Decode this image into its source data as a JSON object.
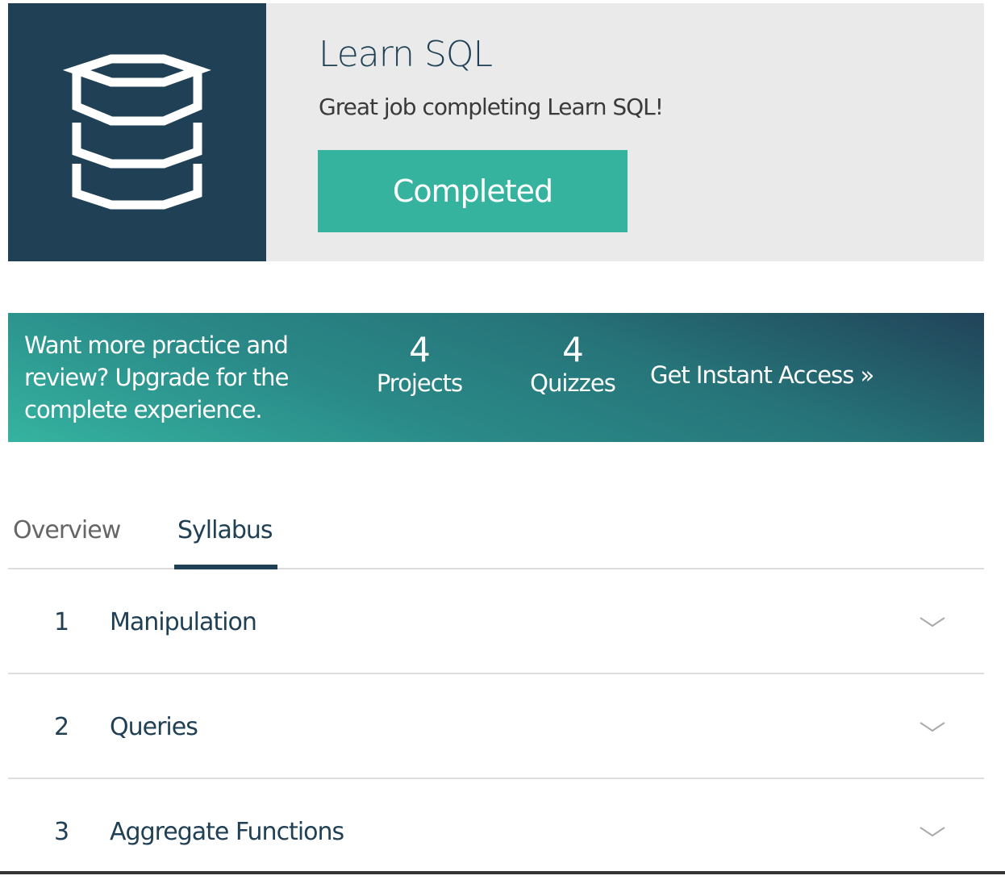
{
  "course": {
    "title": "Learn SQL",
    "subtitle": "Great job completing Learn SQL!",
    "status_button": "Completed",
    "icon": "database-icon"
  },
  "upgrade": {
    "text": "Want more practice and review? Upgrade for the complete experience.",
    "stats": [
      {
        "value": "4",
        "label": "Projects"
      },
      {
        "value": "4",
        "label": "Quizzes"
      }
    ],
    "cta": "Get Instant Access »"
  },
  "tabs": [
    {
      "label": "Overview",
      "active": false
    },
    {
      "label": "Syllabus",
      "active": true
    }
  ],
  "syllabus": [
    {
      "number": "1",
      "title": "Manipulation"
    },
    {
      "number": "2",
      "title": "Queries"
    },
    {
      "number": "3",
      "title": "Aggregate Functions"
    }
  ],
  "colors": {
    "navy": "#204056",
    "teal": "#35b39f",
    "gray": "#e9eae9"
  }
}
